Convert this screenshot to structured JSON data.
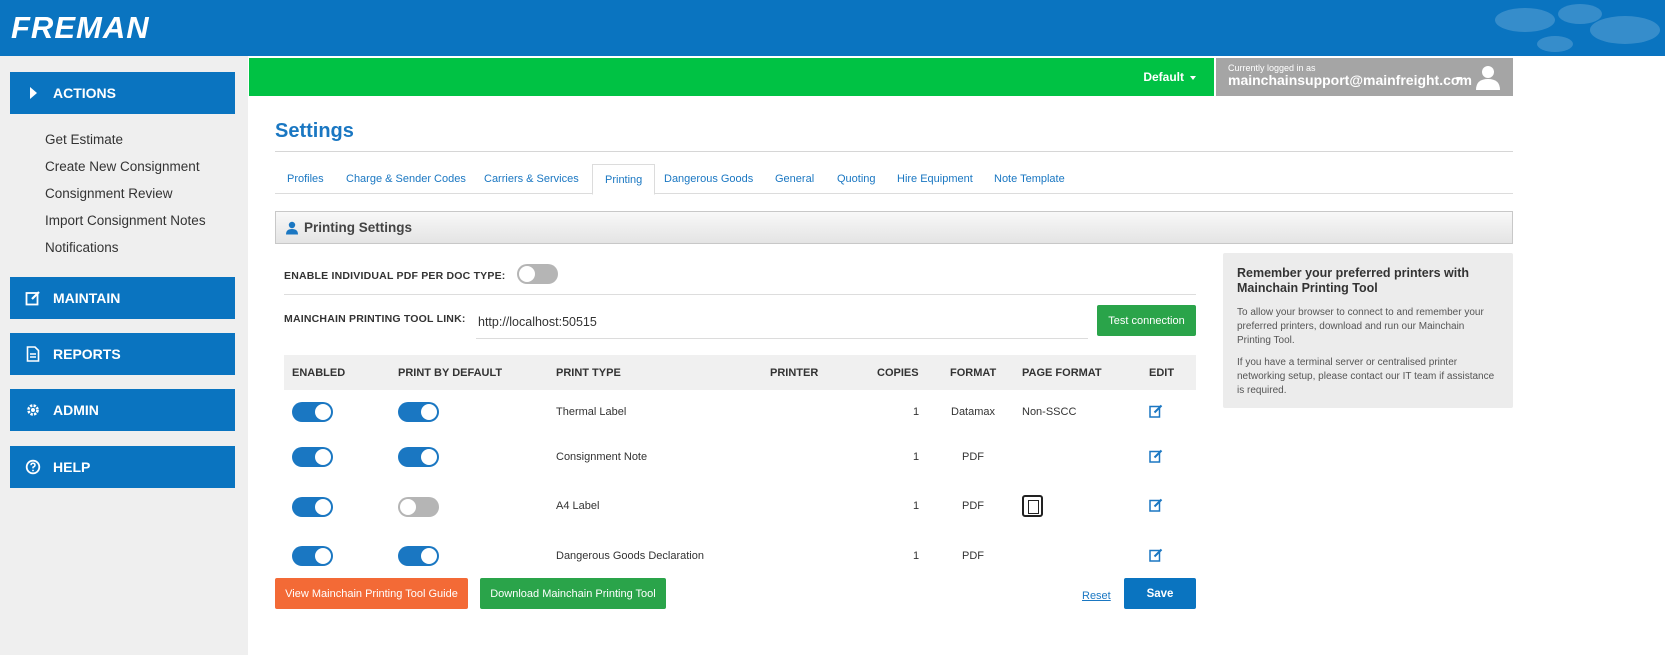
{
  "app": {
    "logo_text": "FREMAN",
    "brand_color": "#0a74c0",
    "accent_green": "#00c244"
  },
  "header": {
    "profile_selector": "Default",
    "user_caption": "Currently logged in as",
    "user_email": "mainchainsupport@mainfreight.com"
  },
  "sidebar": {
    "actions_label": "ACTIONS",
    "action_links": [
      "Get Estimate",
      "Create New Consignment",
      "Consignment Review",
      "Import Consignment Notes",
      "Notifications"
    ],
    "maintain_label": "MAINTAIN",
    "reports_label": "REPORTS",
    "admin_label": "ADMIN",
    "help_label": "HELP"
  },
  "main": {
    "title": "Settings",
    "tabs": [
      "Profiles",
      "Charge & Sender Codes",
      "Carriers & Services",
      "Printing",
      "Dangerous Goods",
      "General",
      "Quoting",
      "Hire Equipment",
      "Note Template"
    ],
    "active_tab": "Printing",
    "panel_title": "Printing Settings",
    "pdf_per_doc_label": "ENABLE INDIVIDUAL PDF PER DOC TYPE:",
    "pdf_per_doc_enabled": false,
    "tool_link_label": "MAINCHAIN PRINTING TOOL LINK:",
    "tool_link_value": "http://localhost:50515",
    "test_connection_label": "Test connection",
    "table": {
      "headers": [
        "ENABLED",
        "PRINT BY DEFAULT",
        "PRINT TYPE",
        "PRINTER",
        "COPIES",
        "FORMAT",
        "PAGE FORMAT",
        "EDIT"
      ],
      "rows": [
        {
          "enabled": true,
          "print_by_default": true,
          "print_type": "Thermal Label",
          "printer": "",
          "copies": "1",
          "format": "Datamax",
          "page_format": "Non-SSCC",
          "page_format_icon": ""
        },
        {
          "enabled": true,
          "print_by_default": true,
          "print_type": "Consignment Note",
          "printer": "",
          "copies": "1",
          "format": "PDF",
          "page_format": "",
          "page_format_icon": ""
        },
        {
          "enabled": true,
          "print_by_default": false,
          "print_type": "A4 Label",
          "printer": "",
          "copies": "1",
          "format": "PDF",
          "page_format": "",
          "page_format_icon": "page-layout-icon"
        },
        {
          "enabled": true,
          "print_by_default": true,
          "print_type": "Dangerous Goods Declaration",
          "printer": "",
          "copies": "1",
          "format": "PDF",
          "page_format": "",
          "page_format_icon": ""
        }
      ]
    },
    "guide_button_label": "View Mainchain Printing Tool Guide",
    "download_button_label": "Download Mainchain Printing Tool",
    "reset_label": "Reset",
    "save_label": "Save"
  },
  "info_box": {
    "title": "Remember your preferred printers with Mainchain Printing Tool",
    "paragraph1": "To allow your browser to connect to and remember your preferred printers, download and run our Mainchain Printing Tool.",
    "paragraph2": "If you have a terminal server or centralised printer networking setup, please contact our IT team if assistance is required."
  }
}
